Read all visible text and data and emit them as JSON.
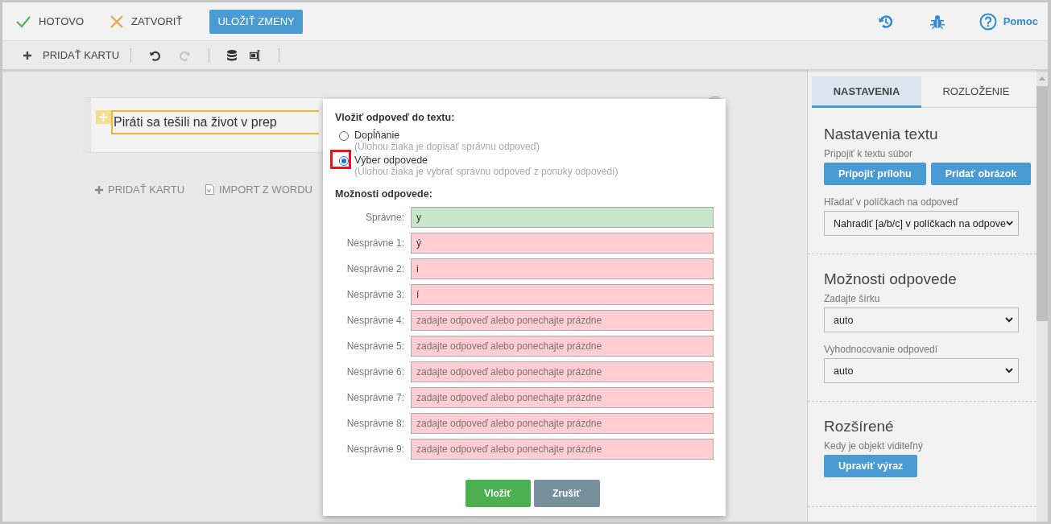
{
  "header": {
    "actions": [
      {
        "kind": "done",
        "label": "HOTOVO"
      },
      {
        "kind": "close",
        "label": "ZATVORIŤ"
      }
    ],
    "save_button": "ULOŽIŤ ZMENY",
    "help_label": "Pomoc"
  },
  "toolbar": {
    "add_card": "PRIDAŤ KARTU",
    "undo_disabled": false,
    "redo_disabled": true
  },
  "canvas": {
    "card_text": "Piráti sa tešili na život v prep",
    "add_card": "PRIDAŤ KARTU",
    "import": "IMPORT Z WORDU"
  },
  "dialog": {
    "title": "Vložiť odpoveď do textu:",
    "modes": [
      {
        "label": "Dopĺňanie",
        "hint": "(Úlohou žiaka je dopísať správnu odpoveď)",
        "selected": false,
        "highlighted": false
      },
      {
        "label": "Výber odpovede",
        "hint": "(Úlohou žiaka je vybrať správnu odpoveď z ponuky odpovedí)",
        "selected": true,
        "highlighted": true
      }
    ],
    "options_title": "Možnosti odpovede:",
    "answers": [
      {
        "kind": "correct",
        "label": "Správne:",
        "value": "y"
      },
      {
        "kind": "wrong",
        "label": "Nesprávne 1:",
        "value": "ý"
      },
      {
        "kind": "wrong",
        "label": "Nesprávne 2:",
        "value": "i"
      },
      {
        "kind": "wrong",
        "label": "Nesprávne 3:",
        "value": "í"
      },
      {
        "kind": "wrong",
        "label": "Nesprávne 4:",
        "placeholder": "zadajte odpoveď alebo ponechajte prázdne"
      },
      {
        "kind": "wrong",
        "label": "Nesprávne 5:",
        "placeholder": "zadajte odpoveď alebo ponechajte prázdne"
      },
      {
        "kind": "wrong",
        "label": "Nesprávne 6:",
        "placeholder": "zadajte odpoveď alebo ponechajte prázdne"
      },
      {
        "kind": "wrong",
        "label": "Nesprávne 7:",
        "placeholder": "zadajte odpoveď alebo ponechajte prázdne"
      },
      {
        "kind": "wrong",
        "label": "Nesprávne 8:",
        "placeholder": "zadajte odpoveď alebo ponechajte prázdne"
      },
      {
        "kind": "wrong",
        "label": "Nesprávne 9:",
        "placeholder": "zadajte odpoveď alebo ponechajte prázdne"
      }
    ],
    "buttons": [
      {
        "kind": "primary",
        "label": "Vložiť"
      },
      {
        "kind": "secondary",
        "label": "Zrušiť"
      }
    ]
  },
  "sidebar": {
    "tabs": [
      {
        "label": "NASTAVENIA",
        "selected": true
      },
      {
        "label": "ROZLOŽENIE",
        "selected": false
      }
    ],
    "sections": [
      {
        "title": "Nastavenia textu",
        "items": [
          {
            "kind": "label",
            "text": "Pripojiť k textu súbor"
          },
          {
            "kind": "buttons",
            "buttons": [
              "Pripojiť prílohu",
              "Pridať obrázok"
            ]
          },
          {
            "kind": "label",
            "text": "Hľadať v políčkach na odpoveď"
          },
          {
            "kind": "select",
            "value": "Nahradiť [a/b/c] v políčkach na odpove"
          }
        ]
      },
      {
        "title": "Možnosti odpovede",
        "items": [
          {
            "kind": "label",
            "text": "Zadajte šírku"
          },
          {
            "kind": "select",
            "value": "auto"
          },
          {
            "kind": "label",
            "text": "Vyhodnocovanie odpovedí"
          },
          {
            "kind": "select",
            "value": "auto"
          }
        ]
      },
      {
        "title": "Rozšírené",
        "items": [
          {
            "kind": "label",
            "text": "Kedy je objekt viditeľný"
          },
          {
            "kind": "buttons",
            "buttons": [
              "Upraviť výraz"
            ]
          }
        ]
      }
    ]
  }
}
